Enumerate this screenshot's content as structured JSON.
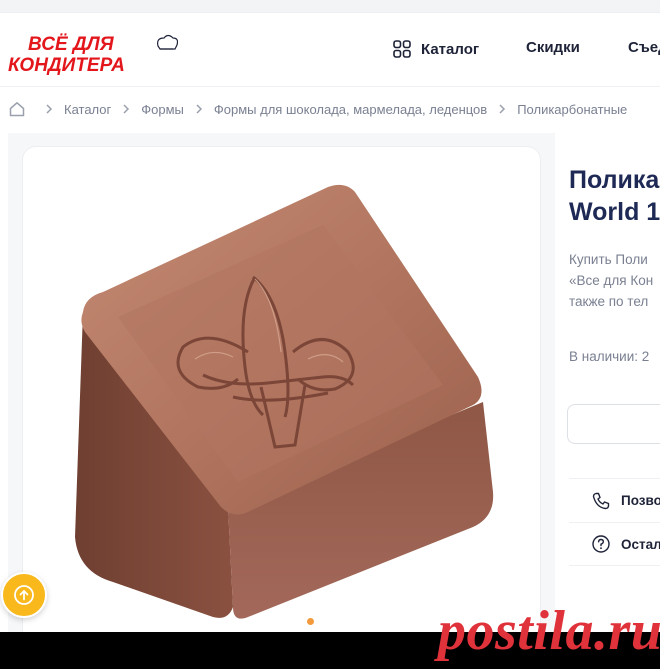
{
  "brand": {
    "logo_line1": "ВСЁ ДЛЯ",
    "logo_line2": "КОНДИТЕРА",
    "logo_color": "#e3161c"
  },
  "nav": {
    "catalog": "Каталог",
    "sale": "Скидки",
    "edible": "Съед"
  },
  "breadcrumb": [
    "Каталог",
    "Формы",
    "Формы для шоколада, мармелада, леденцов",
    "Поликарбонатные"
  ],
  "product": {
    "title_line1": "Полика",
    "title_line2": "World 1",
    "desc_line1": "Купить Поли",
    "desc_line2": "«Все для Кон",
    "desc_line3": "также по тел",
    "stock": "В наличии: 2",
    "call_label": "Позво",
    "question_label": "Остал"
  },
  "gallery": {
    "image": "chocolate-candy-fleur-de-lis",
    "active_slide": 1
  },
  "watermark": "postila.ru",
  "colors": {
    "accent": "#f9b81b",
    "title": "#1e2a55",
    "watermark": "#e0323a",
    "chocolate": "#a86b55"
  }
}
